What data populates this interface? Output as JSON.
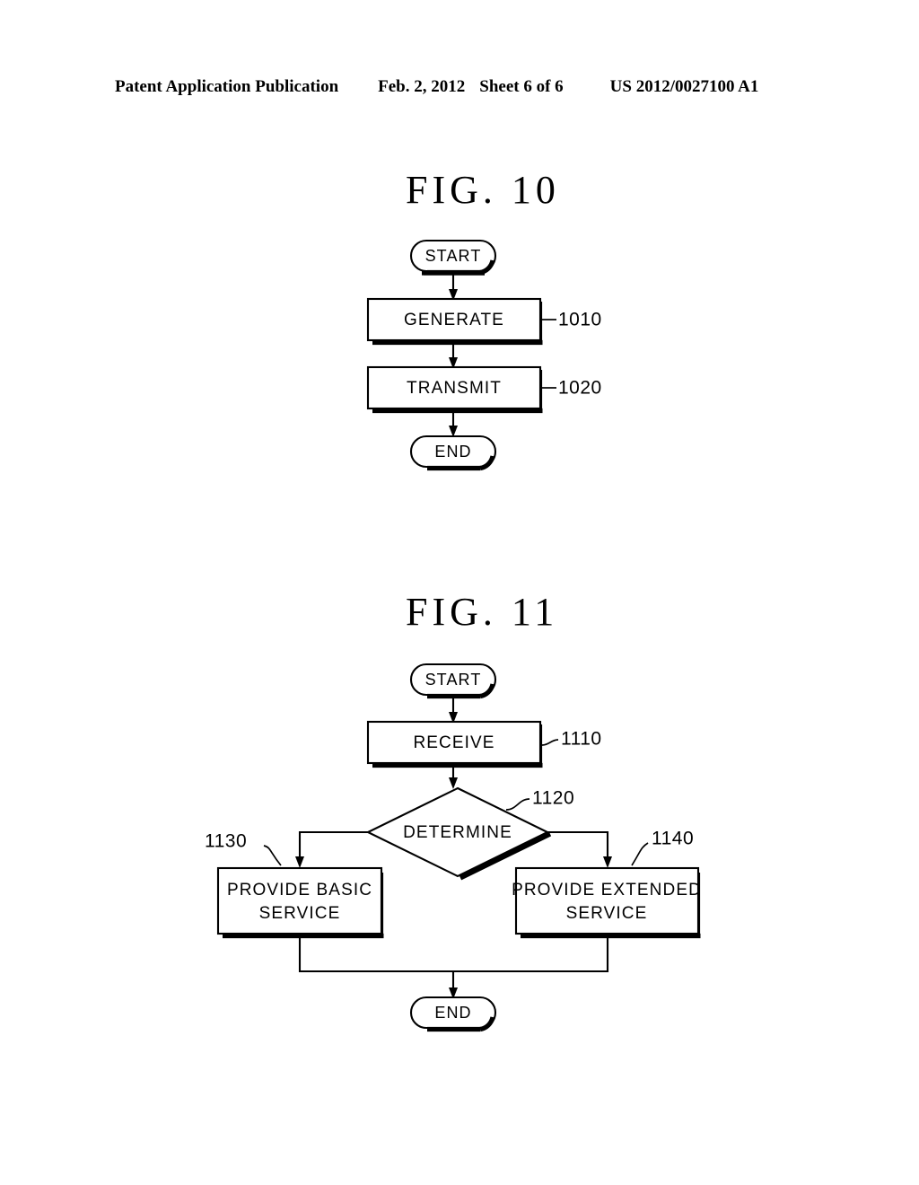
{
  "header": {
    "publication": "Patent Application Publication",
    "date": "Feb. 2, 2012",
    "sheet": "Sheet 6 of 6",
    "serial": "US 2012/0027100 A1"
  },
  "figures": [
    {
      "id": "fig10",
      "title": "FIG.  10",
      "nodes": {
        "start": "START",
        "generate": "GENERATE",
        "transmit": "TRANSMIT",
        "end": "END"
      },
      "refs": {
        "generate": "1010",
        "transmit": "1020"
      }
    },
    {
      "id": "fig11",
      "title": "FIG.  11",
      "nodes": {
        "start": "START",
        "receive": "RECEIVE",
        "determine": "DETERMINE",
        "basic_line1": "PROVIDE BASIC",
        "basic_line2": "SERVICE",
        "extended_line1": "PROVIDE EXTENDED",
        "extended_line2": "SERVICE",
        "end": "END"
      },
      "refs": {
        "receive": "1110",
        "determine": "1120",
        "basic": "1130",
        "extended": "1140"
      }
    }
  ],
  "colors": {
    "ink": "#000000",
    "paper": "#ffffff"
  }
}
